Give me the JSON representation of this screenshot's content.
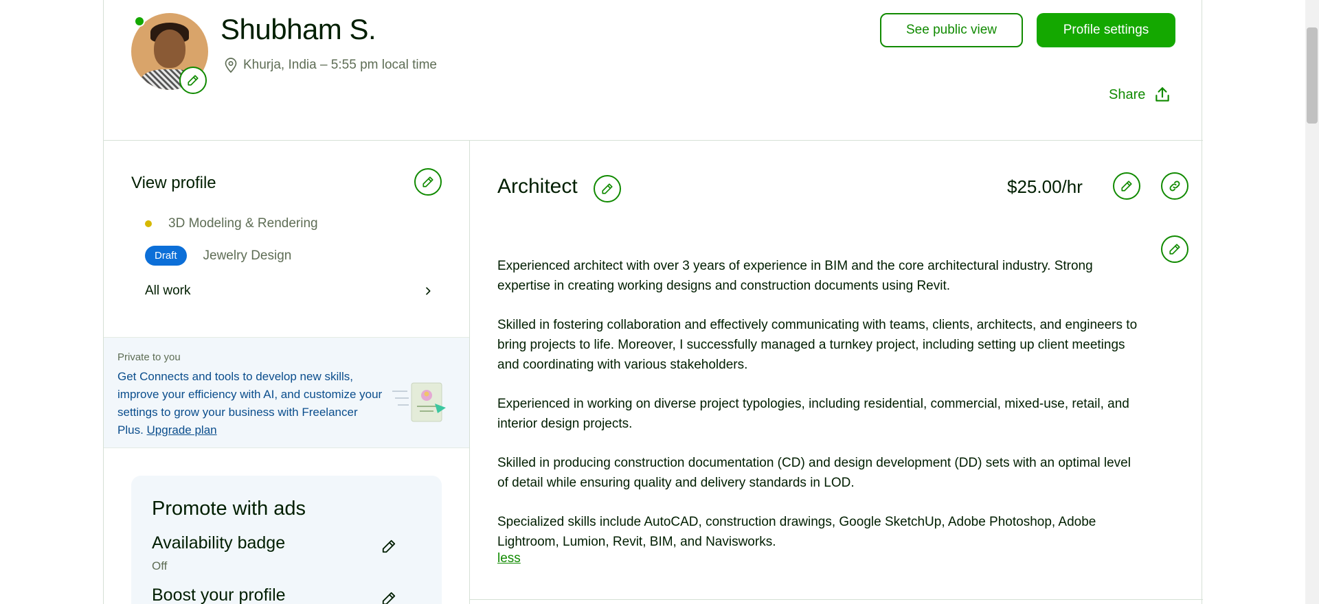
{
  "header": {
    "name": "Shubham S.",
    "location": "Khurja, India – 5:55 pm local time",
    "see_public_view": "See public view",
    "profile_settings": "Profile settings",
    "share": "Share"
  },
  "sidebar": {
    "view_profile_title": "View profile",
    "skills": [
      {
        "label": "3D Modeling & Rendering",
        "status": "active"
      },
      {
        "label": "Jewelry Design",
        "status": "draft",
        "badge": "Draft"
      }
    ],
    "all_work": "All work"
  },
  "private_box": {
    "label": "Private to you",
    "text": "Get Connects and tools to develop new skills, improve your efficiency with AI, and customize your settings to grow your business with Freelancer Plus.",
    "link": "Upgrade plan"
  },
  "promote": {
    "title": "Promote with ads",
    "availability_title": "Availability badge",
    "availability_value": "Off",
    "boost_title": "Boost your profile"
  },
  "main": {
    "role_title": "Architect",
    "rate": "$25.00/hr",
    "description": [
      "Experienced architect with over 3 years of experience in BIM and the core architectural industry. Strong expertise in creating working designs and construction documents using Revit.",
      "Skilled in fostering collaboration and effectively communicating with teams, clients, architects, and engineers to bring projects to life. Moreover, I successfully managed a turnkey project, including setting up client meetings and coordinating with various stakeholders.",
      "Experienced in working on diverse project typologies, including residential, commercial, mixed-use, retail, and interior design projects.",
      "Skilled in producing construction documentation (CD) and design development (DD) sets with an optimal level of detail while ensuring quality and delivery standards in LOD.",
      "Specialized skills include AutoCAD, construction drawings, Google SketchUp, Adobe Photoshop, Adobe Lightroom, Lumion, Revit, BIM, and Navisworks."
    ],
    "less_link": "less"
  },
  "colors": {
    "brand_green": "#14a800",
    "link_green": "#108a00",
    "draft_blue": "#0c6fd8",
    "text_dark": "#001e00",
    "text_muted": "#5e6d55"
  },
  "icons": [
    "pencil-icon",
    "location-pin-icon",
    "share-icon",
    "link-icon",
    "chevron-right-icon"
  ]
}
